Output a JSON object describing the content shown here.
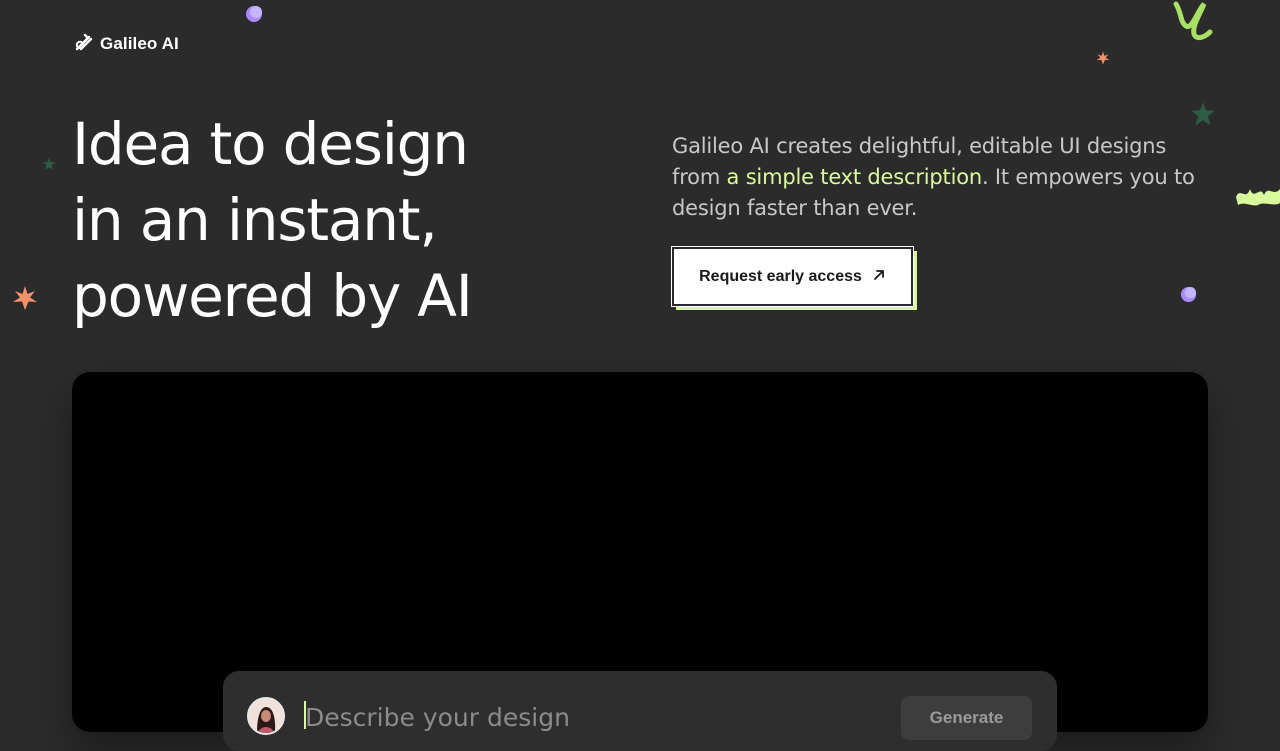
{
  "brand": {
    "name": "Galileo AI",
    "icon": "galileo-logo-icon"
  },
  "hero": {
    "headline_lines": [
      "Idea to design",
      "in an instant,",
      "powered by AI"
    ],
    "description_before": "Galileo AI creates delightful, editable UI designs from ",
    "description_highlight": "a simple text description",
    "description_after": ". It empowers you to design faster than ever.",
    "cta_label": "Request early access",
    "cta_icon": "arrow-up-right-icon"
  },
  "prompt": {
    "placeholder": "Describe your design",
    "value": "",
    "generate_label": "Generate",
    "avatar_icon": "user-avatar"
  },
  "colors": {
    "background": "#2b2b2b",
    "accent": "#d9f99d",
    "text": "#ffffff",
    "muted_text": "#c8c8c8",
    "panel": "#000000",
    "sparkle_orange": "#f4916b",
    "sparkle_green": "#2f5a46",
    "orb_purple": "#a78bfa"
  },
  "decorations": [
    "purple-orb-icon",
    "orange-star-icon",
    "green-star-icon",
    "lime-squiggle-icon",
    "lime-brush-stroke-icon"
  ]
}
